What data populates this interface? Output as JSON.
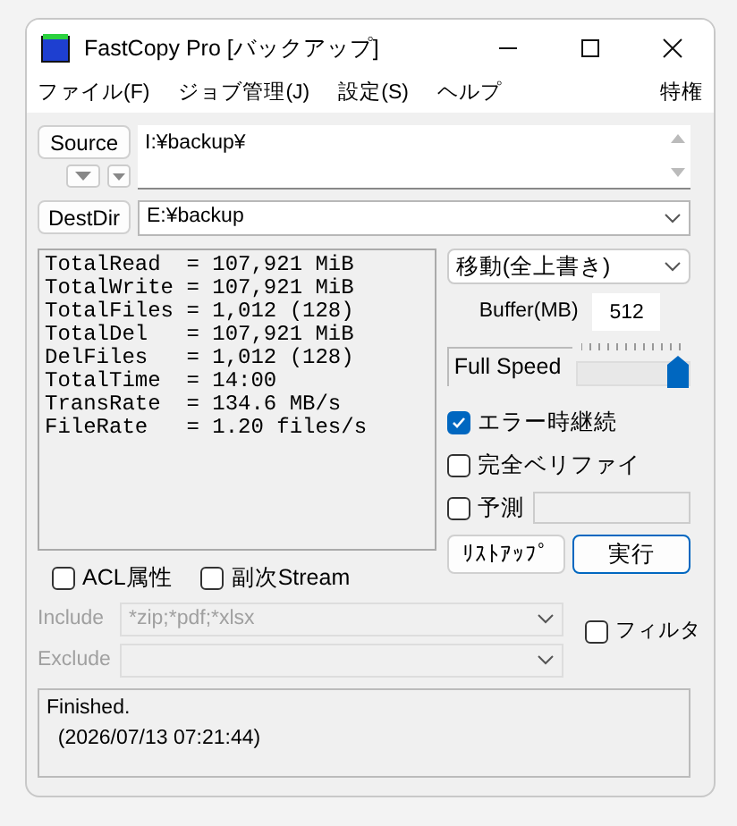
{
  "window": {
    "title": "FastCopy Pro [バックアップ]"
  },
  "menu": [
    "ファイル(F)",
    "ジョブ管理(J)",
    "設定(S)",
    "ヘルプ"
  ],
  "menu_right": "特権",
  "source": {
    "button": "Source",
    "path": "I:¥backup¥"
  },
  "dest": {
    "button": "DestDir",
    "path": "E:¥backup"
  },
  "stats": [
    "TotalRead  = 107,921 MiB",
    "TotalWrite = 107,921 MiB",
    "TotalFiles = 1,012 (128)",
    "TotalDel   = 107,921 MiB",
    "DelFiles   = 1,012 (128)",
    "TotalTime  = 14:00",
    "TransRate  = 134.6 MB/s",
    "FileRate   = 1.20 files/s"
  ],
  "mode": "移動(全上書き)",
  "buffer": {
    "label": "Buffer(MB)",
    "value": "512"
  },
  "speed": {
    "label": "Full Speed",
    "level": 1.0
  },
  "options": [
    {
      "label": "エラー時継続",
      "checked": true
    },
    {
      "label": "完全ベリファイ",
      "checked": false
    },
    {
      "label": "予測",
      "checked": false
    }
  ],
  "bottom_options": [
    {
      "label": "ACL属性",
      "checked": false
    },
    {
      "label": "副次Stream",
      "checked": false
    }
  ],
  "buttons": [
    {
      "label": "ﾘｽﾄｱｯﾌﾟ",
      "default": false
    },
    {
      "label": "実行",
      "default": true
    }
  ],
  "include": {
    "label": "Include",
    "value": "*zip;*pdf;*xlsx",
    "disabled": true
  },
  "exclude": {
    "label": "Exclude",
    "disabled": true
  },
  "filter": {
    "label": "フィルタ",
    "checked": false
  },
  "log": [
    "Finished.",
    "  (2026/07/13 07:21:44)"
  ]
}
